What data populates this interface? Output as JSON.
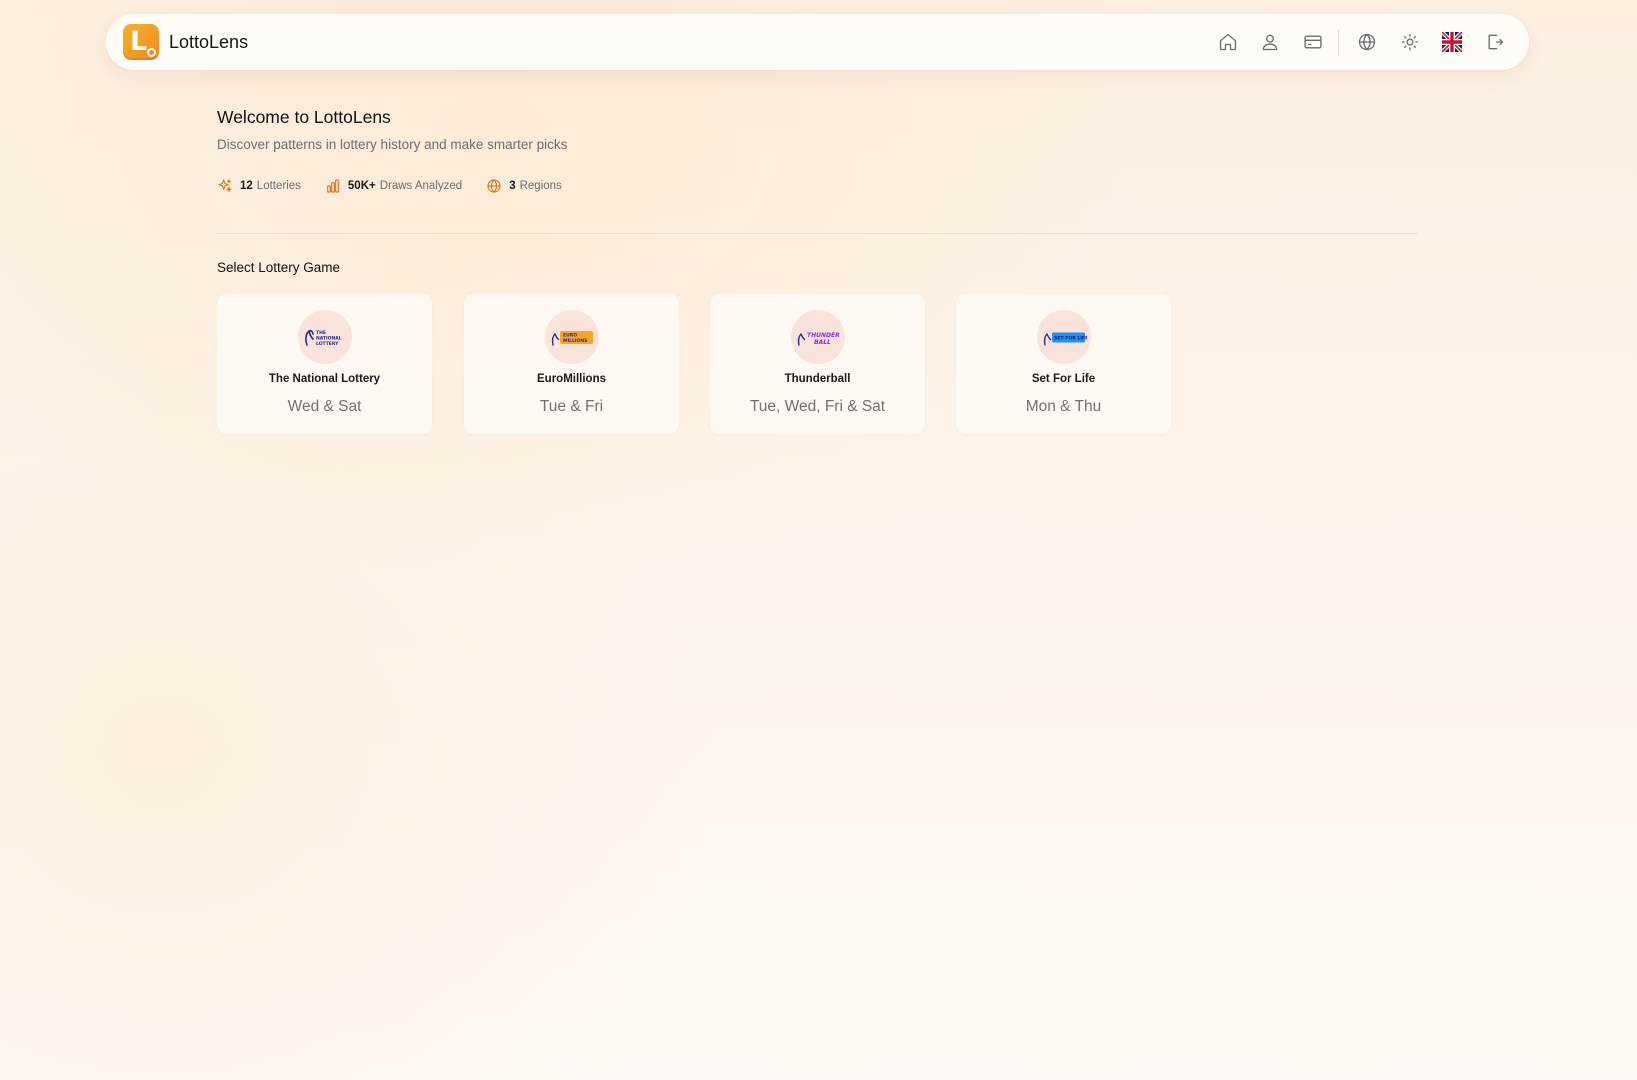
{
  "header": {
    "logo_letter": "L",
    "brand": "LottoLens",
    "nav": [
      {
        "name": "home-icon"
      },
      {
        "name": "user-icon"
      },
      {
        "name": "credit-card-icon"
      },
      {
        "name": "globe-icon"
      },
      {
        "name": "sun-icon"
      },
      {
        "name": "uk-flag-icon"
      },
      {
        "name": "logout-icon"
      }
    ]
  },
  "welcome": {
    "title": "Welcome to LottoLens",
    "subtitle": "Discover patterns in lottery history and make smarter picks"
  },
  "stats": [
    {
      "icon": "sparkles-icon",
      "value": "12",
      "label": "Lotteries"
    },
    {
      "icon": "bar-chart-icon",
      "value": "50K+",
      "label": "Draws Analyzed"
    },
    {
      "icon": "globe-icon",
      "value": "3",
      "label": "Regions"
    }
  ],
  "section_title": "Select Lottery Game",
  "games": [
    {
      "name": "The National Lottery",
      "days": "Wed & Sat",
      "logo_text": "THE NATIONAL LOTTERY",
      "logo_color": "#2b2b8c"
    },
    {
      "name": "EuroMillions",
      "days": "Tue & Fri",
      "logo_text": "EURO MILLIONS",
      "logo_color": "#f5a623"
    },
    {
      "name": "Thunderball",
      "days": "Tue, Wed, Fri & Sat",
      "logo_text": "THUNDER BALL",
      "logo_color": "#8a2be2"
    },
    {
      "name": "Set For Life",
      "days": "Mon & Thu",
      "logo_text": "SET FOR LIFE",
      "logo_color": "#1e90ff"
    }
  ],
  "colors": {
    "accent": "#f08a1c",
    "accent_light": "#f7b02c",
    "card_logo_bg": "#f9e3db"
  }
}
